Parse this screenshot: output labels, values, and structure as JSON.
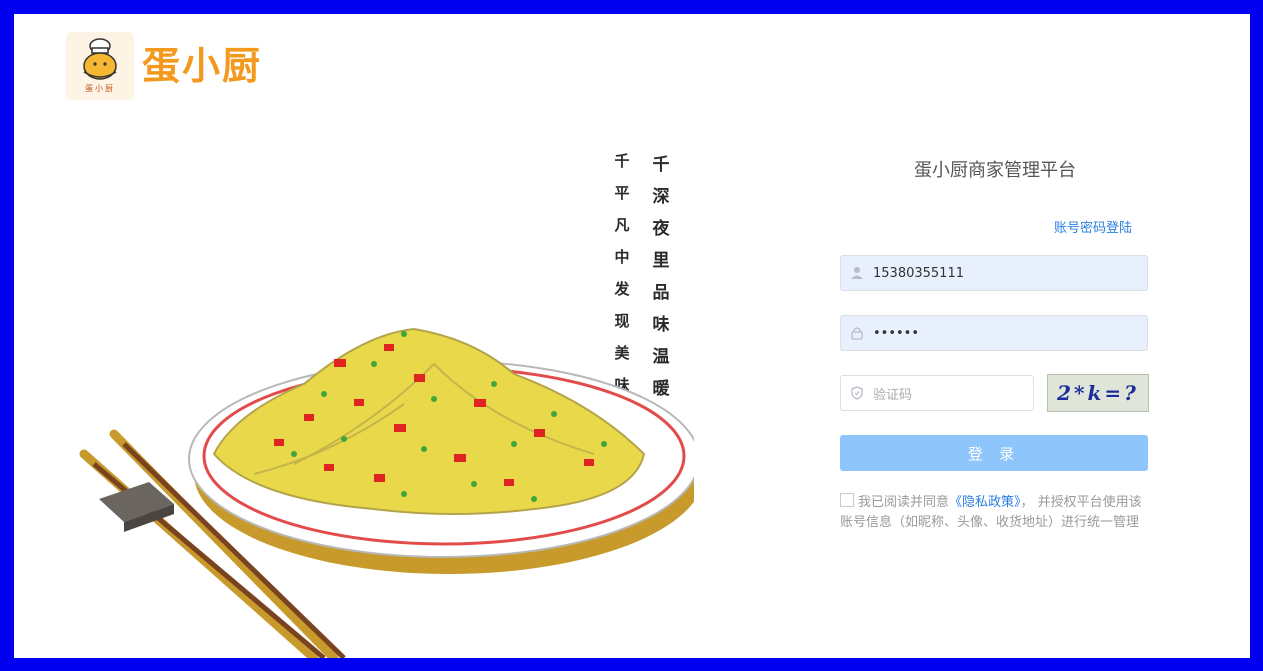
{
  "brand": {
    "name": "蛋小厨",
    "badge_text": "蛋小厨"
  },
  "poem": {
    "line1": [
      "千",
      "平",
      "凡",
      "中",
      "发",
      "现",
      "美",
      "味"
    ],
    "line2": [
      "千",
      "深",
      "夜",
      "里",
      "品",
      "味",
      "温",
      "暖"
    ]
  },
  "login": {
    "title": "蛋小厨商家管理平台",
    "mode_link": "账号密码登陆",
    "username": "15380355111",
    "password_mask": "••••••",
    "code_placeholder": "验证码",
    "captcha_text": "2*k=?",
    "submit_label": "登 录",
    "agree_prefix": "我已阅读并同意",
    "agree_link": "《隐私政策》",
    "agree_suffix": "， 并授权平台使用该账号信息（如昵称、头像、收货地址）进行统一管理"
  },
  "colors": {
    "frame": "#0000ee",
    "brand_orange": "#f39a1e",
    "link_blue": "#2a7fe0",
    "button_blue": "#8ec6fb"
  }
}
